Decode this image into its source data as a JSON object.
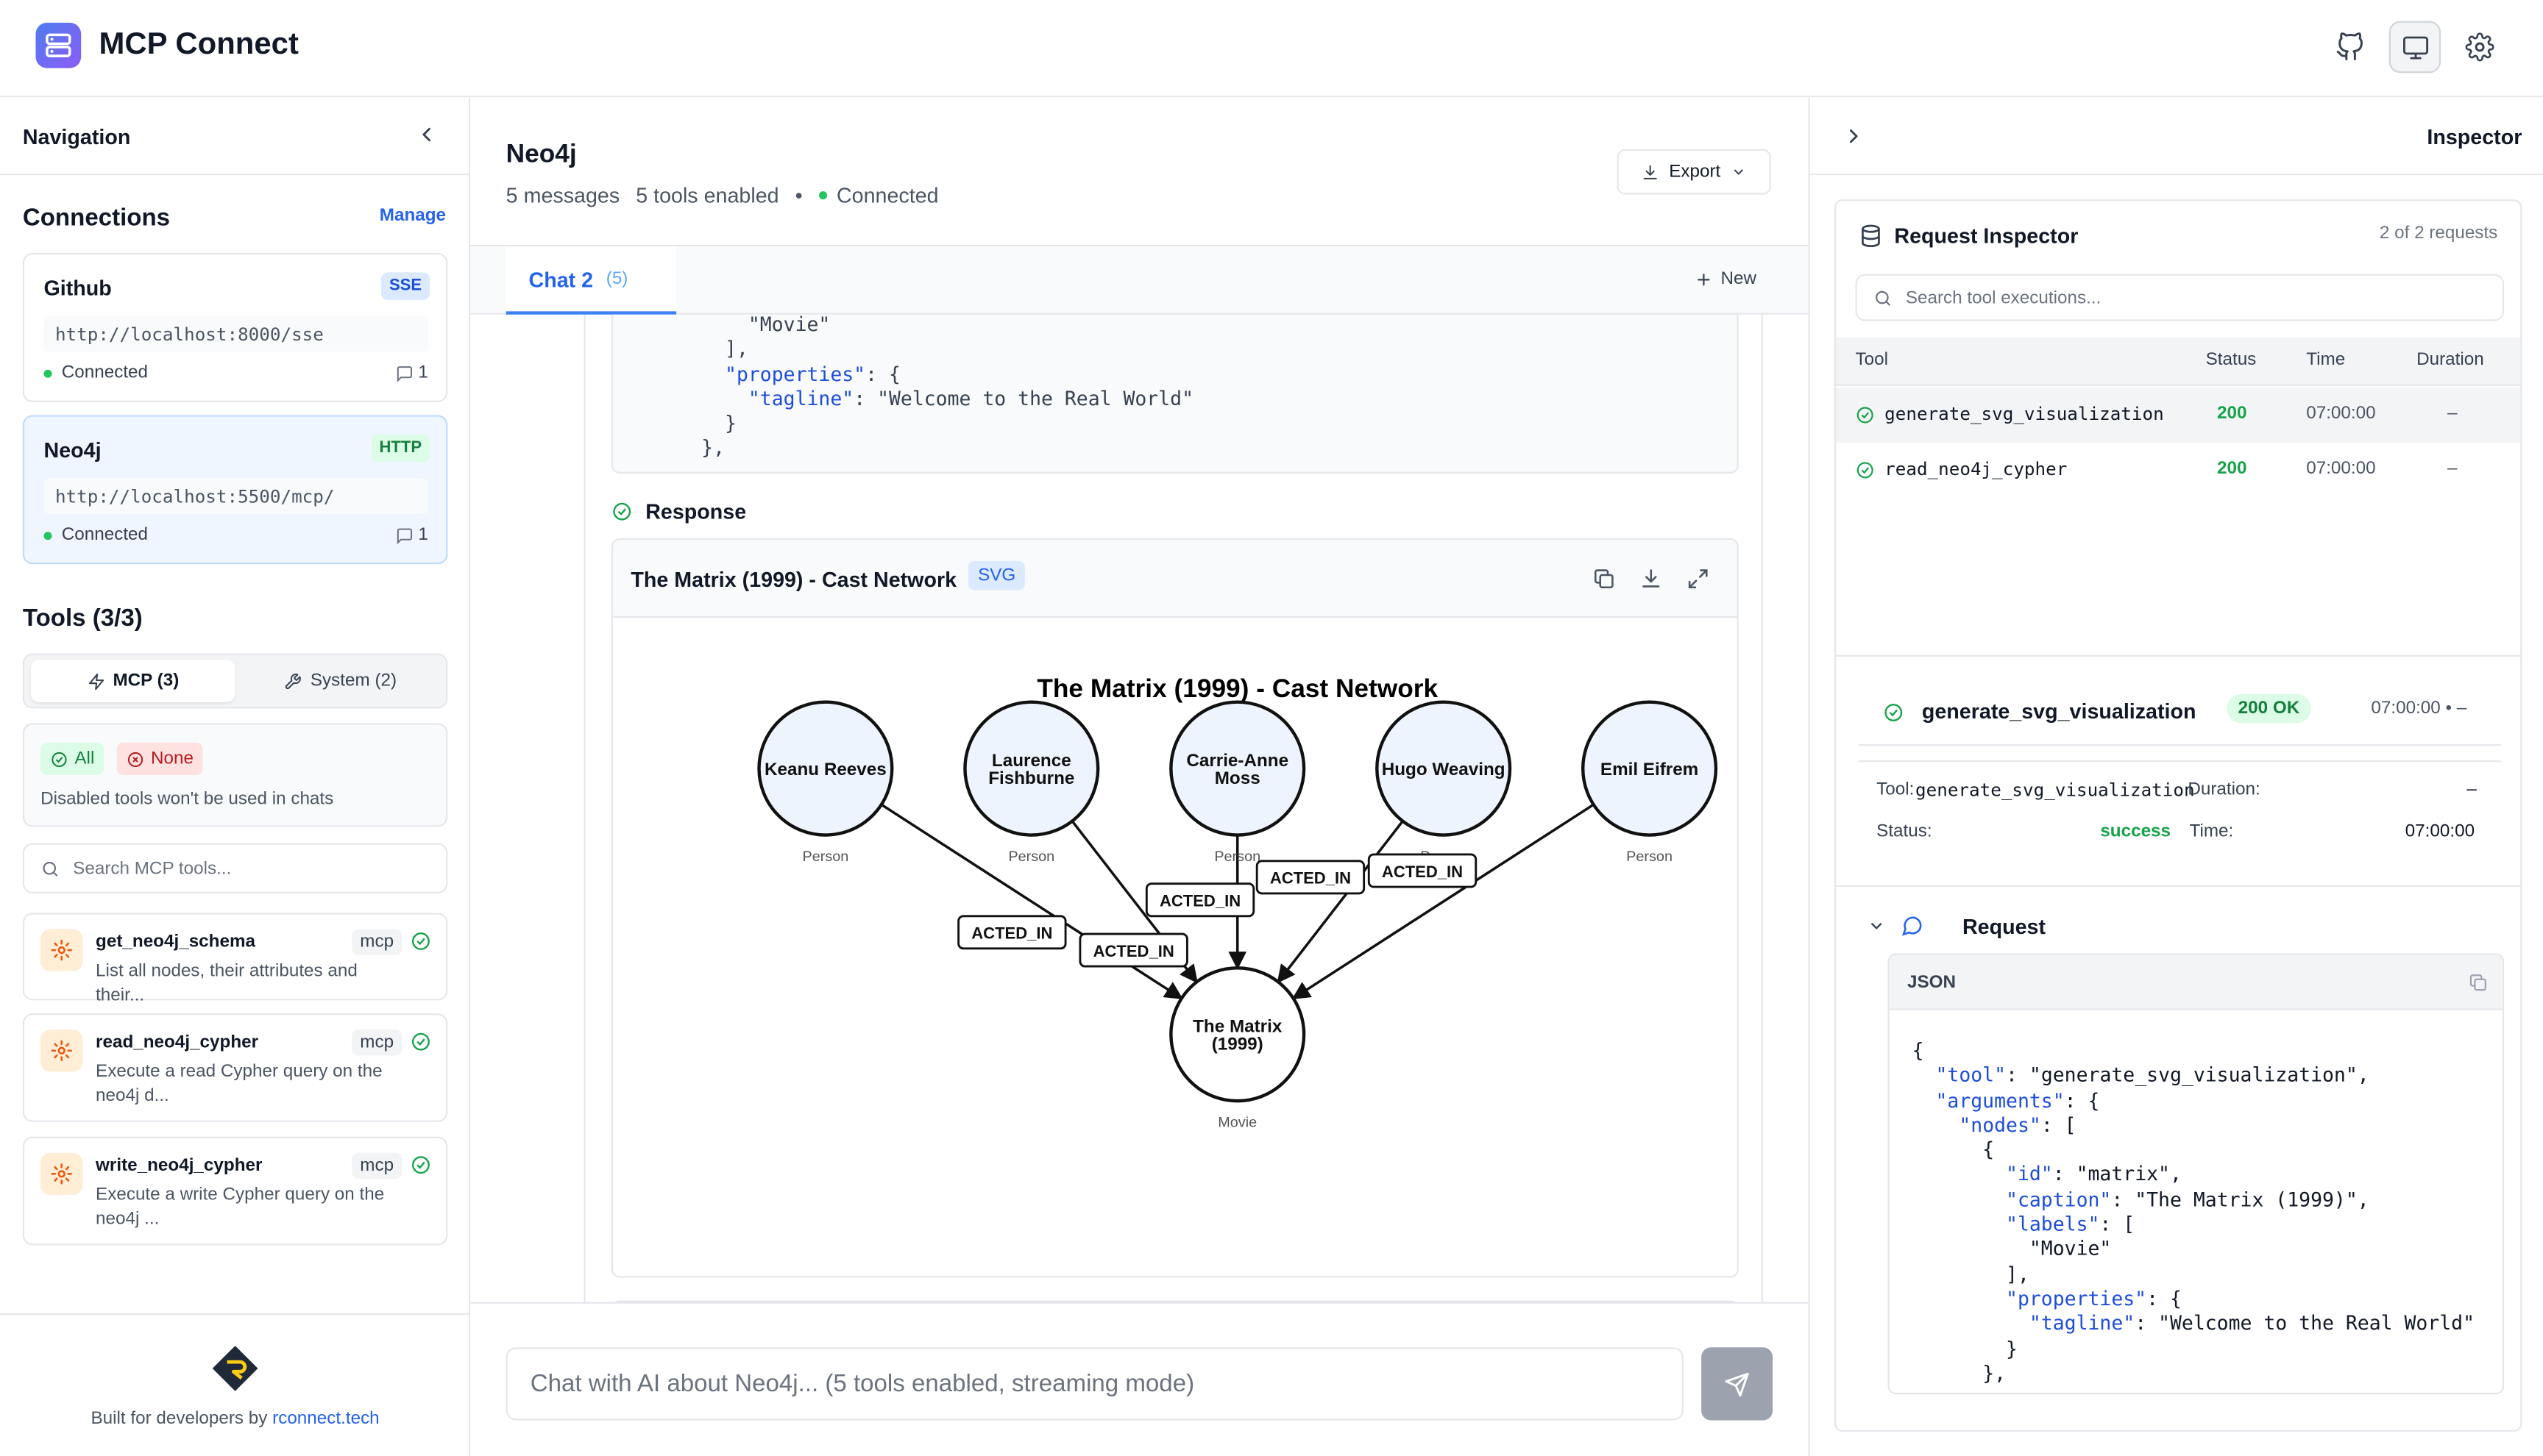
{
  "app": {
    "title": "MCP Connect"
  },
  "header": {
    "icons": [
      "github-icon",
      "monitor-icon",
      "gear-icon"
    ]
  },
  "navigation": {
    "title": "Navigation"
  },
  "connections": {
    "title": "Connections",
    "manage_label": "Manage",
    "items": [
      {
        "name": "Github",
        "transport": "SSE",
        "url": "http://localhost:8000/sse",
        "status": "Connected",
        "count": "1"
      },
      {
        "name": "Neo4j",
        "transport": "HTTP",
        "url": "http://localhost:5500/mcp/",
        "status": "Connected",
        "count": "1"
      }
    ]
  },
  "tools": {
    "title": "Tools (3/3)",
    "tabs": [
      {
        "label": "MCP (3)"
      },
      {
        "label": "System (2)"
      }
    ],
    "filter": {
      "all_label": "All",
      "none_label": "None",
      "note": "Disabled tools won't be used in chats"
    },
    "search_placeholder": "Search MCP tools...",
    "items": [
      {
        "name": "get_neo4j_schema",
        "tag": "mcp",
        "desc": "List all nodes, their attributes and their..."
      },
      {
        "name": "read_neo4j_cypher",
        "tag": "mcp",
        "desc": "Execute a read Cypher query on the neo4j d..."
      },
      {
        "name": "write_neo4j_cypher",
        "tag": "mcp",
        "desc": "Execute a write Cypher query on the neo4j ..."
      }
    ]
  },
  "footer": {
    "prefix": "Built for developers by ",
    "link": "rconnect.tech"
  },
  "chat": {
    "title": "Neo4j",
    "messages": "5 messages",
    "tools_enabled": "5 tools enabled",
    "separator": "•",
    "status": "Connected",
    "export_label": "Export",
    "tab_label": "Chat 2",
    "tab_count": "(5)",
    "new_label": "New",
    "code_lines": [
      {
        "indent": "      ",
        "key": "",
        "text": "\"Movie\""
      },
      {
        "indent": "    ",
        "key": "",
        "text": "],"
      },
      {
        "indent": "    ",
        "key": "\"properties\"",
        "text": ": {"
      },
      {
        "indent": "      ",
        "key": "\"tagline\"",
        "text": ": \"Welcome to the Real World\""
      },
      {
        "indent": "    ",
        "key": "",
        "text": "}"
      },
      {
        "indent": "  ",
        "key": "",
        "text": "},"
      }
    ],
    "response_label": "Response",
    "input_placeholder": "Chat with AI about Neo4j... (5 tools enabled, streaming mode)"
  },
  "visualization": {
    "header_title": "The Matrix (1999) - Cast Network",
    "type_tag": "SVG",
    "actions": [
      "copy-icon",
      "download-icon",
      "expand-icon"
    ],
    "graph_title": "The Matrix (1999) - Cast Network",
    "people": [
      {
        "name_lines": [
          "Keanu Reeves"
        ],
        "label": "Person"
      },
      {
        "name_lines": [
          "Laurence",
          "Fishburne"
        ],
        "label": "Person"
      },
      {
        "name_lines": [
          "Carrie-Anne",
          "Moss"
        ],
        "label": "Person"
      },
      {
        "name_lines": [
          "Hugo Weaving"
        ],
        "label": "Person"
      },
      {
        "name_lines": [
          "Emil Eifrem"
        ],
        "label": "Person"
      }
    ],
    "movie": {
      "name_lines": [
        "The Matrix",
        "(1999)"
      ],
      "label": "Movie"
    },
    "edge_label": "ACTED_IN"
  },
  "inspector": {
    "title": "Inspector",
    "panel_title": "Request Inspector",
    "count": "2 of 2 requests",
    "search_placeholder": "Search tool executions...",
    "columns": {
      "tool": "Tool",
      "status": "Status",
      "time": "Time",
      "duration": "Duration"
    },
    "rows": [
      {
        "tool": "generate_svg_visualization",
        "status": "200",
        "time": "07:00:00",
        "duration": "–"
      },
      {
        "tool": "read_neo4j_cypher",
        "status": "200",
        "time": "07:00:00",
        "duration": "–"
      }
    ],
    "detail": {
      "name": "generate_svg_visualization",
      "badge": "200 OK",
      "time": "07:00:00 • –",
      "tool_label": "Tool:",
      "tool_value": "generate_svg_visualization",
      "duration_label": "Duration:",
      "duration_value": "–",
      "status_label": "Status:",
      "status_value": "success",
      "time_label": "Time:",
      "time_value": "07:00:00"
    },
    "request": {
      "title": "Request",
      "format": "JSON",
      "json_lines": [
        {
          "indent": "",
          "key": "",
          "text": "{"
        },
        {
          "indent": "  ",
          "key": "\"tool\"",
          "text": ": \"generate_svg_visualization\","
        },
        {
          "indent": "  ",
          "key": "\"arguments\"",
          "text": ": {"
        },
        {
          "indent": "    ",
          "key": "\"nodes\"",
          "text": ": ["
        },
        {
          "indent": "      ",
          "key": "",
          "text": "{"
        },
        {
          "indent": "        ",
          "key": "\"id\"",
          "text": ": \"matrix\","
        },
        {
          "indent": "        ",
          "key": "\"caption\"",
          "text": ": \"The Matrix (1999)\","
        },
        {
          "indent": "        ",
          "key": "\"labels\"",
          "text": ": ["
        },
        {
          "indent": "          ",
          "key": "",
          "text": "\"Movie\""
        },
        {
          "indent": "        ",
          "key": "",
          "text": "],"
        },
        {
          "indent": "        ",
          "key": "\"properties\"",
          "text": ": {"
        },
        {
          "indent": "          ",
          "key": "\"tagline\"",
          "text": ": \"Welcome to the Real World\""
        },
        {
          "indent": "        ",
          "key": "",
          "text": "}"
        },
        {
          "indent": "      ",
          "key": "",
          "text": "},"
        }
      ]
    }
  }
}
